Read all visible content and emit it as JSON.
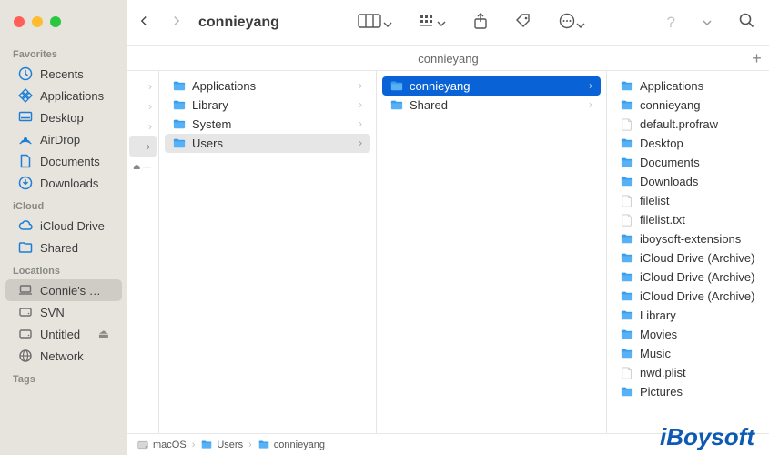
{
  "window": {
    "title": "connieyang",
    "tab_title": "connieyang"
  },
  "sidebar": {
    "sections": [
      {
        "label": "Favorites",
        "items": [
          {
            "icon": "clock",
            "label": "Recents"
          },
          {
            "icon": "appgrid",
            "label": "Applications"
          },
          {
            "icon": "desktop",
            "label": "Desktop"
          },
          {
            "icon": "airdrop",
            "label": "AirDrop"
          },
          {
            "icon": "doc",
            "label": "Documents"
          },
          {
            "icon": "download",
            "label": "Downloads"
          }
        ]
      },
      {
        "label": "iCloud",
        "items": [
          {
            "icon": "cloud",
            "label": "iCloud Drive"
          },
          {
            "icon": "sharedfolder",
            "label": "Shared"
          }
        ]
      },
      {
        "label": "Locations",
        "items": [
          {
            "icon": "laptop",
            "label": "Connie's Ma…",
            "selected": true
          },
          {
            "icon": "disk",
            "label": "SVN"
          },
          {
            "icon": "disk",
            "label": "Untitled",
            "eject": true
          },
          {
            "icon": "globe",
            "label": "Network"
          }
        ]
      },
      {
        "label": "Tags",
        "items": []
      }
    ]
  },
  "columns": {
    "col0": [
      {
        "chev": true
      },
      {
        "chev": true
      },
      {
        "chev": true
      },
      {
        "chev": true,
        "selected": true
      }
    ],
    "col1": [
      {
        "type": "folder",
        "label": "Applications"
      },
      {
        "type": "folder",
        "label": "Library"
      },
      {
        "type": "folder",
        "label": "System"
      },
      {
        "type": "folder",
        "label": "Users",
        "selected": "highlight"
      }
    ],
    "col2": [
      {
        "type": "folder",
        "label": "connieyang",
        "selected": "selected"
      },
      {
        "type": "folder",
        "label": "Shared"
      }
    ],
    "col3": [
      {
        "type": "folder",
        "label": "Applications"
      },
      {
        "type": "folder",
        "label": "connieyang"
      },
      {
        "type": "file",
        "label": "default.profraw"
      },
      {
        "type": "folder",
        "label": "Desktop"
      },
      {
        "type": "folder",
        "label": "Documents"
      },
      {
        "type": "folder",
        "label": "Downloads"
      },
      {
        "type": "file",
        "label": "filelist"
      },
      {
        "type": "file",
        "label": "filelist.txt"
      },
      {
        "type": "folder",
        "label": "iboysoft-extensions"
      },
      {
        "type": "folder",
        "label": "iCloud Drive (Archive)"
      },
      {
        "type": "folder",
        "label": "iCloud Drive (Archive)"
      },
      {
        "type": "folder",
        "label": "iCloud Drive (Archive)"
      },
      {
        "type": "folder",
        "label": "Library"
      },
      {
        "type": "folder",
        "label": "Movies"
      },
      {
        "type": "folder",
        "label": "Music"
      },
      {
        "type": "file",
        "label": "nwd.plist"
      },
      {
        "type": "folder",
        "label": "Pictures"
      }
    ]
  },
  "path": [
    {
      "icon": "disk",
      "label": "macOS"
    },
    {
      "icon": "folder",
      "label": "Users"
    },
    {
      "icon": "folder",
      "label": "connieyang"
    }
  ],
  "watermark": "iBoysoft",
  "colors": {
    "accent": "#0a63d6",
    "folder": "#2d9bf0",
    "sidebar_bg": "#e7e4de"
  }
}
